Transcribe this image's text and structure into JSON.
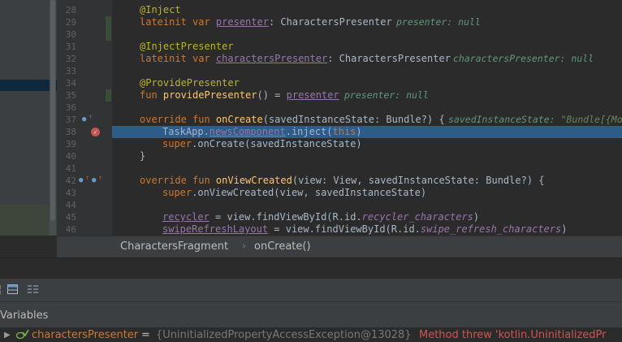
{
  "gutter": {
    "line_numbers": [
      "28",
      "29",
      "30",
      "31",
      "32",
      "33",
      "34",
      "35",
      "36",
      "37",
      "38",
      "39",
      "40",
      "41",
      "42",
      "43",
      "44",
      "45",
      "46"
    ]
  },
  "code": {
    "l28": {
      "annotation": "@Inject"
    },
    "l29": {
      "kw": "lateinit var ",
      "prop": "presenter",
      "rest": ": CharactersPresenter",
      "hint": "presenter: null"
    },
    "l31": {
      "annotation": "@InjectPresenter"
    },
    "l32": {
      "kw": "lateinit var ",
      "prop": "charactersPresenter",
      "rest": ": CharactersPresenter",
      "hint": "charactersPresenter: null"
    },
    "l34": {
      "annotation": "@ProvidePresenter"
    },
    "l35": {
      "kw": "fun ",
      "fn": "providePresenter",
      "rest": "() = ",
      "prop": "presenter",
      "hint": "presenter: null"
    },
    "l37": {
      "kw": "override fun ",
      "fn": "onCreate",
      "rest": "(savedInstanceState: Bundle?) {",
      "hint": "savedInstanceState: ",
      "hint_str": "\"Bundle[{Mo"
    },
    "l38": {
      "pre": "TaskApp.",
      "prop": "newsComponent",
      "mid": ".inject(",
      "kw": "this",
      "post": ")"
    },
    "l39": {
      "kw": "super",
      "rest": ".onCreate(savedInstanceState)"
    },
    "l40": {
      "text": "}"
    },
    "l42": {
      "kw": "override fun ",
      "fn": "onViewCreated",
      "rest": "(view: View, savedInstanceState: Bundle?) {"
    },
    "l43": {
      "kw": "super",
      "rest": ".onViewCreated(view, savedInstanceState)"
    },
    "l45": {
      "prop": "recycler",
      "rest": " = view.findViewById(R.id.",
      "itprop": "recycler_characters",
      "post": ")"
    },
    "l46": {
      "prop": "swipeRefreshLayout",
      "rest": " = view.findViewById(R.id.",
      "itprop": "swipe_refresh_characters",
      "post": ")"
    }
  },
  "breadcrumb": {
    "class_name": "CharactersFragment",
    "separator": "›",
    "method_name": "onCreate()"
  },
  "debugger": {
    "panel_title": "Variables",
    "variable": {
      "name": "charactersPresenter",
      "equals": " = ",
      "value": "{UninitializedPropertyAccessException@13028}",
      "error": " Method threw 'kotlin.UninitializedPr"
    }
  },
  "icons": {
    "override": "override-icon",
    "implemented": "implemented-icon",
    "breakpoint": "breakpoint-icon"
  },
  "colors": {
    "keyword": "#cc7832",
    "annotation": "#bbb529",
    "property": "#9876aa",
    "function": "#ffc66d",
    "highlight": "#2d5b8a",
    "error": "#d25252"
  }
}
